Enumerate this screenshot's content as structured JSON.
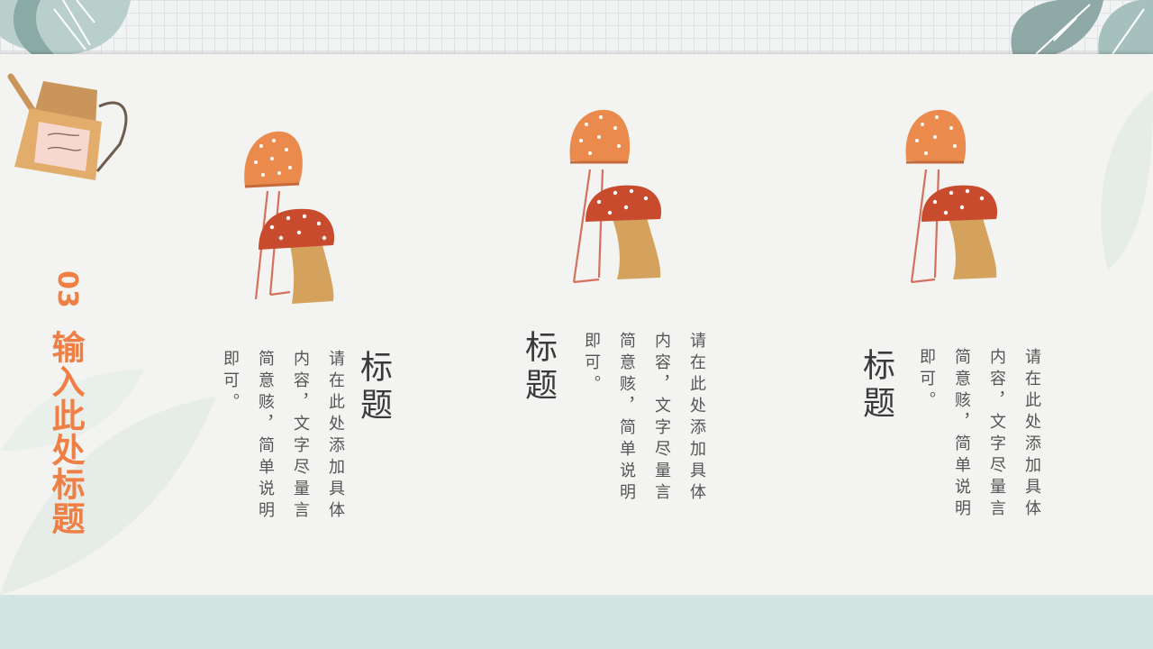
{
  "section": {
    "number": "03",
    "title": "输入此处标题"
  },
  "columns": [
    {
      "heading": "标题",
      "body": "请在此处添加具体内容，文字尽量言简意赅，简单说明即可。"
    },
    {
      "heading": "标题",
      "body": "请在此处添加具体内容，文字尽量言简意赅，简单说明即可。"
    },
    {
      "heading": "标题",
      "body": "请在此处添加具体内容，文字尽量言简意赅，简单说明即可。"
    }
  ],
  "colors": {
    "accent": "#ef7f45",
    "background": "#d3e4e2",
    "paper": "#f3f3f1"
  },
  "icons": [
    "leaf-decoration",
    "watering-can-illustration",
    "mushroom-illustration"
  ]
}
